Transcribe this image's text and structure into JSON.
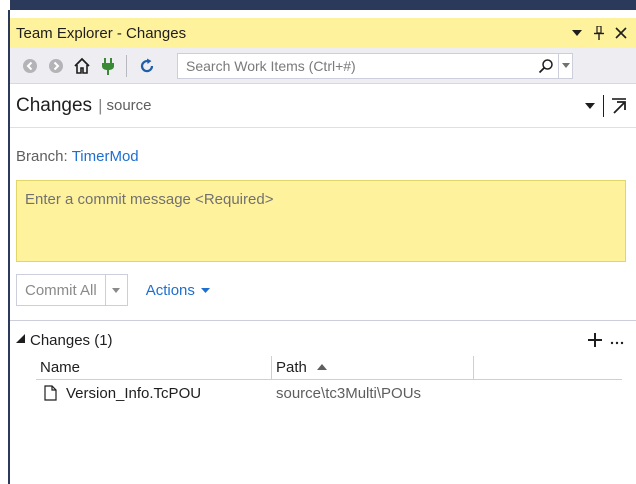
{
  "window": {
    "title": "Team Explorer - Changes"
  },
  "titlebar": {
    "dropdown_icon": "dropdown-arrow-icon",
    "pin_icon": "pin-icon",
    "close_icon": "close-icon"
  },
  "toolbar": {
    "icons": [
      "back-arrow-icon",
      "forward-arrow-icon",
      "home-icon",
      "connect-plug-icon",
      "refresh-icon"
    ],
    "search": {
      "placeholder": "Search Work Items (Ctrl+#)"
    }
  },
  "header": {
    "title": "Changes",
    "separator": "|",
    "subtitle": "source"
  },
  "branch": {
    "label": "Branch:",
    "name": "TimerMod"
  },
  "commit": {
    "placeholder": "Enter a commit message <Required>"
  },
  "actions": {
    "commit_all_label": "Commit All",
    "actions_label": "Actions"
  },
  "changes_section": {
    "title": "Changes (1)",
    "columns": {
      "name": "Name",
      "path": "Path"
    },
    "rows": [
      {
        "name": "Version_Info.TcPOU",
        "path": "source\\tc3Multi\\POUs"
      }
    ]
  },
  "colors": {
    "accent_yellow": "#fff29d",
    "link_blue": "#1e6fcf",
    "toolbar_bg": "#eeeef2",
    "frame_dark": "#2b3a5a"
  }
}
